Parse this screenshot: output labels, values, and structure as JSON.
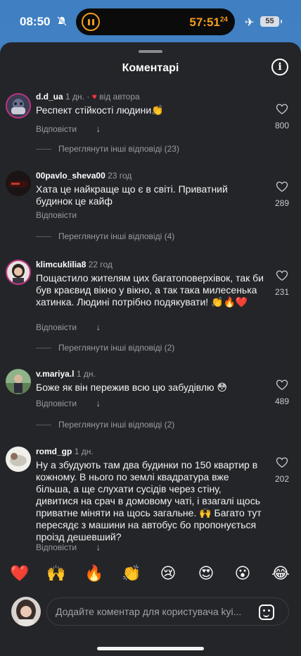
{
  "status_bar": {
    "time": "08:50",
    "timer": "57:51",
    "timer_fraction": "24",
    "battery": "55"
  },
  "sheet": {
    "title": "Коментарі",
    "info_icon": "info-icon"
  },
  "labels": {
    "reply": "Відповісти"
  },
  "comments": [
    {
      "user": "d.d_ua",
      "time": "1 дн.",
      "author_badge": "від автора",
      "text": "Респект стійкості людини👏",
      "likes": "800",
      "replies": "Переглянути інші відповіді (23)"
    },
    {
      "user": "00pavlo_sheva00",
      "time": "23 год",
      "text": "Хата це найкраще що є в світі. Приватний будинок це кайф",
      "likes": "289",
      "replies": "Переглянути інші відповіді (4)"
    },
    {
      "user": "klimcuklilia8",
      "time": "22 год",
      "text": "Пощастило жителям цих багатоповерхівок, так би був краєвид вікно у вікно, а так така милесенька хатинка. Людині потрібно подякувати! 👏🔥❤️",
      "likes": "231",
      "replies": "Переглянути інші відповіді (2)"
    },
    {
      "user": "v.mariya.l",
      "time": "1 дн.",
      "text": "Боже як він пережив всю цю забудівлю 😳",
      "likes": "489",
      "replies": "Переглянути інші відповіді (2)"
    },
    {
      "user": "romd_gp",
      "time": "1 дн.",
      "text": "Ну а збудують там два будинки по 150 квартир в кожному. В нього по землі квадратура вже більша, а ще слухати сусідів через стіну, дивитися на срач в домовому чаті, і взагалі щось приватне міняти на щось загальне. 🙌 Багато тут пересядє з машини на автобус бо пропонується проізд дешевший?",
      "likes": "202"
    }
  ],
  "emoji_bar": [
    "❤️",
    "🙌",
    "🔥",
    "👏",
    "😢",
    "😍",
    "😮",
    "😂"
  ],
  "composer": {
    "placeholder": "Додайте коментар для користувача kyi...",
    "sticker_icon": "sticker-icon"
  }
}
